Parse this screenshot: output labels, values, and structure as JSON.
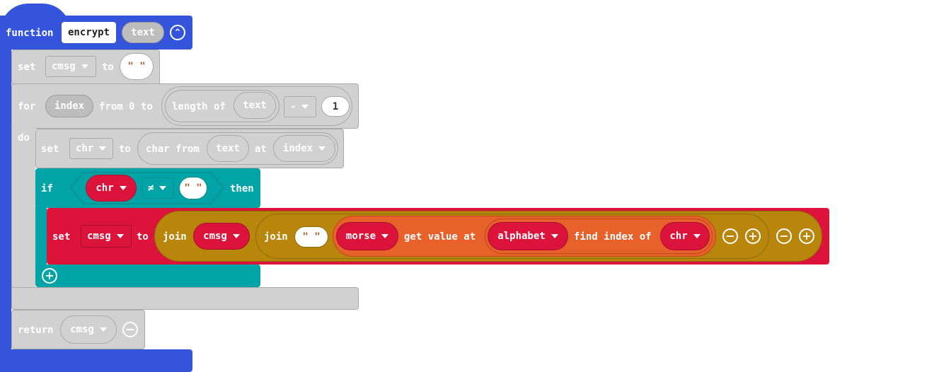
{
  "function_block": {
    "keyword": "function",
    "name": "encrypt",
    "param": "text",
    "color": "#3455db"
  },
  "set_cmsg": {
    "set": "set",
    "var": "cmsg",
    "to": "to",
    "value": "\" \""
  },
  "for_loop": {
    "for": "for",
    "var": "index",
    "from": "from 0 to",
    "length_of": "length of",
    "length_arg": "text",
    "op": "-",
    "operand": "1",
    "do": "do"
  },
  "set_chr": {
    "set": "set",
    "var": "chr",
    "to": "to",
    "char_from": "char from",
    "char_arg": "text",
    "at": "at",
    "index_var": "index"
  },
  "if_block": {
    "if": "if",
    "var": "chr",
    "op": "≠",
    "value": "\" \"",
    "then": "then",
    "color": "#00a4a6"
  },
  "set_join": {
    "set": "set",
    "var": "cmsg",
    "to": "to",
    "join1": "join",
    "join1_var": "cmsg",
    "join2": "join",
    "join2_str": "\" \"",
    "morse": "morse",
    "get_value_at": "get value at",
    "alphabet": "alphabet",
    "find_index_of": "find index of",
    "chr": "chr",
    "color": "#dc143c"
  },
  "return_block": {
    "return": "return",
    "var": "cmsg"
  }
}
